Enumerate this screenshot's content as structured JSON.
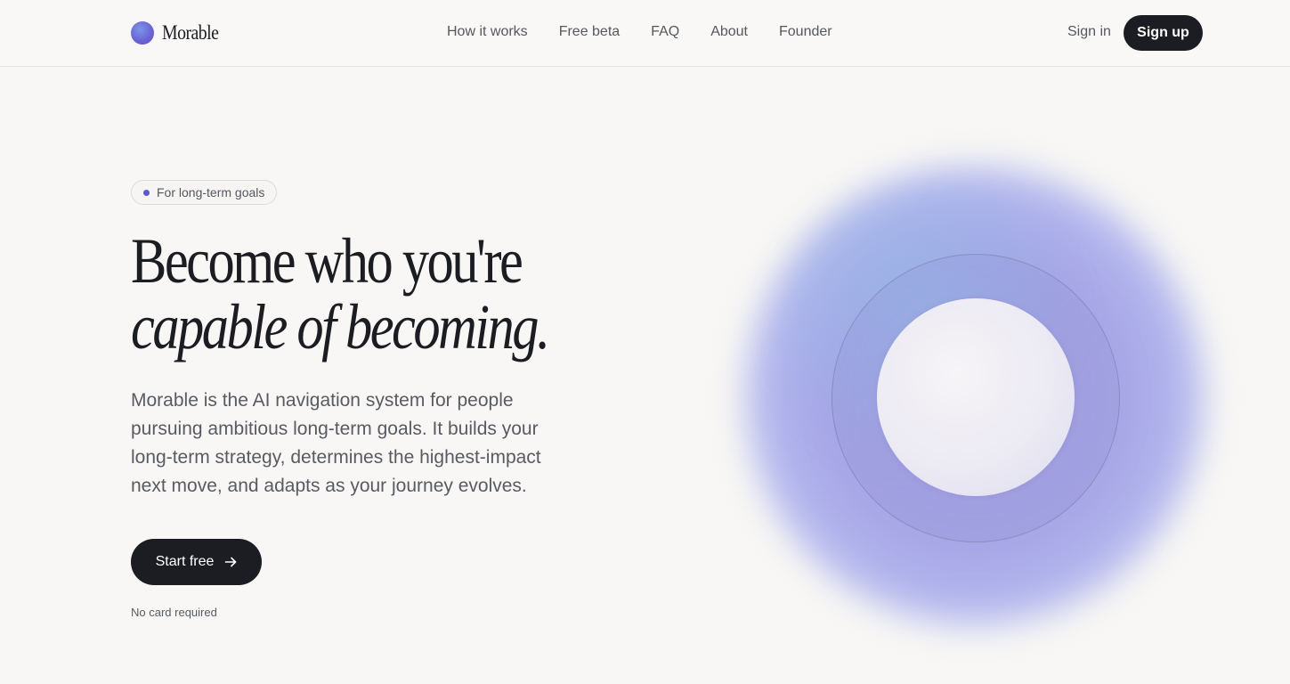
{
  "header": {
    "brand_name": "Morable",
    "nav": [
      {
        "label": "How it works"
      },
      {
        "label": "Free beta"
      },
      {
        "label": "FAQ"
      },
      {
        "label": "About"
      },
      {
        "label": "Founder"
      }
    ],
    "sign_in": "Sign in",
    "sign_up": "Sign up"
  },
  "hero": {
    "badge": "For long-term goals",
    "headline_line1": "Become who you're",
    "headline_line2": "capable of becoming.",
    "description": "Morable is the AI navigation system for people pursuing ambitious long-term goals. It builds your long-term strategy, determines the highest-impact next move, and adapts as your journey evolves.",
    "cta_label": "Start free",
    "cta_icon": "arrow-right-icon",
    "note": "No card required"
  },
  "colors": {
    "background": "#f8f7f5",
    "primary_dark": "#1b1d22",
    "accent": "#5b58d6",
    "orb_purple": "#9e96e0",
    "orb_blue": "#96b9e6"
  }
}
